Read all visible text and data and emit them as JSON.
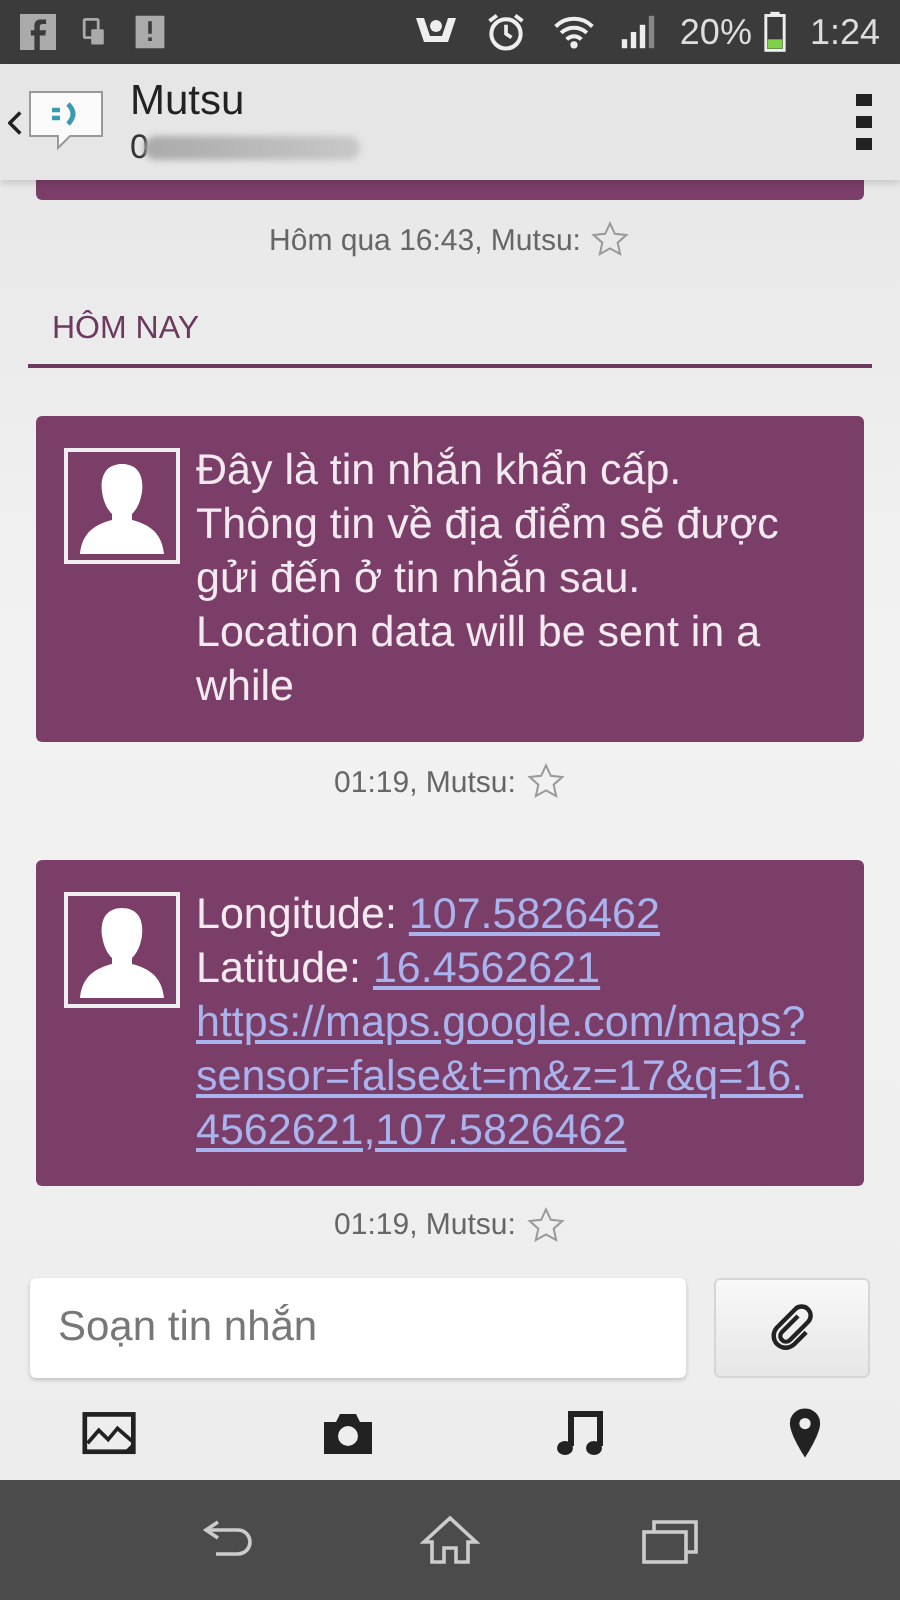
{
  "status_bar": {
    "battery": "20%",
    "time": "1:24"
  },
  "header": {
    "title": "Mutsu",
    "subtitle": "0"
  },
  "earlier": {
    "meta": "Hôm qua 16:43, Mutsu:",
    "starred": false
  },
  "section": "HÔM NAY",
  "messages": [
    {
      "parts": [
        {
          "kind": "text",
          "text": "Đây là tin nhắn khẩn cấp. Thông tin về địa điểm sẽ được gửi đến ở tin nhắn sau. Location data will be sent in a while"
        }
      ],
      "meta": "01:19, Mutsu:",
      "starred": false
    },
    {
      "parts": [
        {
          "kind": "text",
          "text": "Longitude: "
        },
        {
          "kind": "link",
          "text": "107.5826462"
        },
        {
          "kind": "break"
        },
        {
          "kind": "text",
          "text": "Latitude: "
        },
        {
          "kind": "link",
          "text": "16.4562621"
        },
        {
          "kind": "break"
        },
        {
          "kind": "link",
          "text": "https://maps.google.com/maps?sensor=false&t=m&z=17&q=16.4562621,107.5826462"
        }
      ],
      "meta": "01:19, Mutsu:",
      "starred": false
    }
  ],
  "composer": {
    "placeholder": "Soạn tin nhắn"
  }
}
